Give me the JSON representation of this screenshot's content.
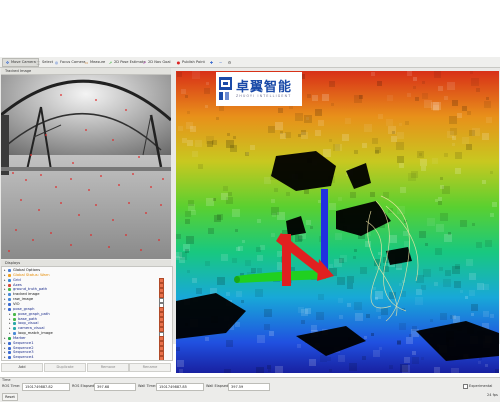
{
  "toolbar": {
    "items": [
      {
        "label": "Move Camera",
        "icon": "move-camera-icon",
        "active": true
      },
      {
        "label": "Select",
        "icon": "select-icon"
      },
      {
        "label": "Focus Camera",
        "icon": "focus-camera-icon"
      },
      {
        "label": "Measure",
        "icon": "measure-icon"
      },
      {
        "label": "2D Pose Estimate",
        "icon": "pose-estimate-icon"
      },
      {
        "label": "2D Nav Goal",
        "icon": "nav-goal-icon"
      },
      {
        "label": "Publish Point",
        "icon": "publish-point-icon"
      }
    ],
    "extra_icons": [
      "add-icon",
      "remove-icon",
      "camera-view-icon"
    ]
  },
  "camera_panel": {
    "title": "Tracked Image"
  },
  "displays_panel": {
    "title": "Displays",
    "items": [
      {
        "label": "Global Options",
        "depth": 0,
        "expanded": false,
        "color": "#4a7fd4",
        "checked": null,
        "style": "dark"
      },
      {
        "label": "Global Status: Warn",
        "depth": 0,
        "expanded": false,
        "color": "#f0a020",
        "checked": null,
        "style": "hl"
      },
      {
        "label": "Grid",
        "depth": 0,
        "expanded": false,
        "color": "#3a8ad8",
        "checked": true,
        "style": "normal"
      },
      {
        "label": "Axes",
        "depth": 0,
        "expanded": false,
        "color": "#d84a3a",
        "checked": true,
        "style": "normal"
      },
      {
        "label": "ground_truth_path",
        "depth": 0,
        "expanded": false,
        "color": "#4ab84a",
        "checked": true,
        "style": "normal"
      },
      {
        "label": "tracked image",
        "depth": 0,
        "expanded": false,
        "color": "#4a8ad8",
        "checked": true,
        "style": "dark"
      },
      {
        "label": "raw_image",
        "depth": 0,
        "expanded": false,
        "color": "#4a8ad8",
        "checked": false,
        "style": "dark"
      },
      {
        "label": "VIO",
        "depth": 0,
        "expanded": true,
        "color": "#3a6ad0",
        "checked": false,
        "style": "dark"
      },
      {
        "label": "pose_graph",
        "depth": 0,
        "expanded": true,
        "color": "#3a6ad0",
        "checked": true,
        "style": "normal"
      },
      {
        "label": "pose_graph_path",
        "depth": 1,
        "expanded": false,
        "color": "#4ab84a",
        "checked": true,
        "style": "normal"
      },
      {
        "label": "base_path",
        "depth": 1,
        "expanded": false,
        "color": "#4ab84a",
        "checked": true,
        "style": "normal"
      },
      {
        "label": "loop_visual",
        "depth": 1,
        "expanded": false,
        "color": "#2aa8a8",
        "checked": true,
        "style": "normal"
      },
      {
        "label": "camera_visual",
        "depth": 1,
        "expanded": false,
        "color": "#2aa8a8",
        "checked": true,
        "style": "normal"
      },
      {
        "label": "loop_match_image",
        "depth": 1,
        "expanded": false,
        "color": "#4a8ad8",
        "checked": false,
        "style": "dark"
      },
      {
        "label": "Marker",
        "depth": 0,
        "expanded": false,
        "color": "#2aa84a",
        "checked": true,
        "style": "normal"
      },
      {
        "label": "Sequence1",
        "depth": 0,
        "expanded": false,
        "color": "#3a6ad0",
        "checked": true,
        "style": "normal"
      },
      {
        "label": "Sequence2",
        "depth": 0,
        "expanded": false,
        "color": "#3a6ad0",
        "checked": true,
        "style": "normal"
      },
      {
        "label": "Sequence3",
        "depth": 0,
        "expanded": false,
        "color": "#3a6ad0",
        "checked": true,
        "style": "normal"
      },
      {
        "label": "Sequence4",
        "depth": 0,
        "expanded": false,
        "color": "#3a6ad0",
        "checked": true,
        "style": "normal"
      }
    ],
    "buttons": [
      "Add",
      "Duplicate",
      "Remove",
      "Rename"
    ]
  },
  "logo": {
    "text": "卓翼智能",
    "subtitle": "ZHUOYI INTELLIGENT"
  },
  "time": {
    "title": "Time",
    "ros_time_label": "ROS Time:",
    "ros_time": "1501749887.82",
    "ros_elapsed_label": "ROS Elapsed:",
    "ros_elapsed": "397.68",
    "wall_time_label": "Wall Time:",
    "wall_time": "1501749887.85",
    "wall_elapsed_label": "Wall Elapsed:",
    "wall_elapsed": "397.59",
    "experimental_label": "Experimental",
    "reset_label": "Reset",
    "fps": "24 fps"
  },
  "colors": {
    "accent": "#3a6ad0",
    "warn": "#f0a020",
    "axis_x": "#e02020",
    "axis_y": "#20d020",
    "axis_z": "#2030e0"
  }
}
